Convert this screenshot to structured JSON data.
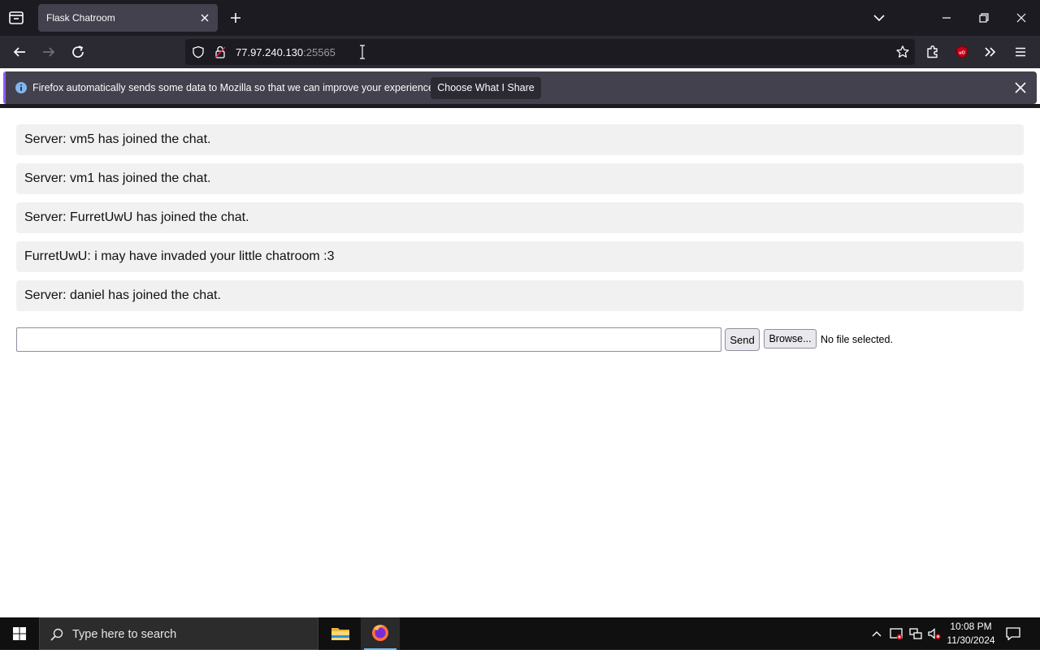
{
  "browser": {
    "tab_title": "Flask Chatroom",
    "url_host": "77.97.240.130",
    "url_port": ":25565",
    "notification_text": "Firefox automatically sends some data to Mozilla so that we can improve your experience.",
    "notification_button": "Choose What I Share",
    "accent_color": "#9059ff"
  },
  "chat": {
    "messages": [
      "Server: vm5 has joined the chat.",
      "Server: vm1 has joined the chat.",
      "Server: FurretUwU has joined the chat.",
      "FurretUwU: i may have invaded your little chatroom :3",
      "Server: daniel has joined the chat."
    ],
    "input_value": "",
    "send_label": "Send",
    "browse_label": "Browse...",
    "file_status": "No file selected."
  },
  "taskbar": {
    "search_placeholder": "Type here to search",
    "time": "10:08 PM",
    "date": "11/30/2024",
    "active_indicator_color": "#76b9ed"
  }
}
